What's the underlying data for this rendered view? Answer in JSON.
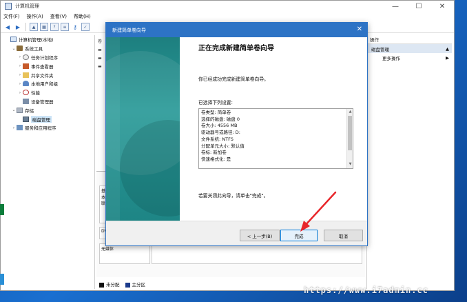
{
  "window": {
    "title": "计算机管理",
    "controls": {
      "minimize": "—",
      "maximize": "☐",
      "close": "✕"
    }
  },
  "menu": [
    "文件(F)",
    "操作(A)",
    "查看(V)",
    "帮助(H)"
  ],
  "tree": [
    {
      "label": "计算机管理(本地)",
      "icon": "computer-icon",
      "indent": 0,
      "arrow": ""
    },
    {
      "label": "系统工具",
      "icon": "tools-icon",
      "indent": 1,
      "arrow": "⌄"
    },
    {
      "label": "任务计划程序",
      "icon": "clock-icon",
      "indent": 2,
      "arrow": "›"
    },
    {
      "label": "事件查看器",
      "icon": "event-icon",
      "indent": 2,
      "arrow": "›"
    },
    {
      "label": "共享文件夹",
      "icon": "folder-icon",
      "indent": 2,
      "arrow": "›"
    },
    {
      "label": "本地用户和组",
      "icon": "users-icon",
      "indent": 2,
      "arrow": "›"
    },
    {
      "label": "性能",
      "icon": "performance-icon",
      "indent": 2,
      "arrow": "›"
    },
    {
      "label": "设备管理器",
      "icon": "device-icon",
      "indent": 2,
      "arrow": ""
    },
    {
      "label": "存储",
      "icon": "storage-icon",
      "indent": 1,
      "arrow": "⌄"
    },
    {
      "label": "磁盘管理",
      "icon": "disk-icon",
      "indent": 2,
      "arrow": "",
      "selected": true
    },
    {
      "label": "服务和应用程序",
      "icon": "services-icon",
      "indent": 1,
      "arrow": "›"
    }
  ],
  "center": {
    "col_head": "卷",
    "disk_label_1": "基\n本\n联",
    "disk_label_2": "DV",
    "disk_label_3": "无媒体"
  },
  "legend": [
    {
      "label": "未分配",
      "color": "#111111"
    },
    {
      "label": "主分区",
      "color": "#1c3b8c"
    }
  ],
  "actions": {
    "header": "操作",
    "section": "磁盘管理",
    "more": "更多操作"
  },
  "wizard": {
    "title": "新建简单卷向导",
    "heading": "正在完成新建简单卷向导",
    "done_text": "你已经成功完成新建简单卷向导。",
    "selected_label": "已选择下列设置:",
    "settings": [
      "卷类型: 简单卷",
      "选择的磁盘: 磁盘 0",
      "卷大小: 4556 MB",
      "驱动器号或路径: D:",
      "文件系统: NTFS",
      "分配单元大小: 默认值",
      "卷标: 新加卷",
      "快速格式化: 是"
    ],
    "close_hint": "若要关闭此向导，请单击\"完成\"。",
    "buttons": {
      "back": "< 上一步(B)",
      "finish": "完成",
      "cancel": "取消"
    }
  },
  "watermark": "https://www.i7admin.cc",
  "colors": {
    "accent": "#2d73c5",
    "annotation_arrow": "#e8262a",
    "wizard_side": "#1e8585"
  }
}
